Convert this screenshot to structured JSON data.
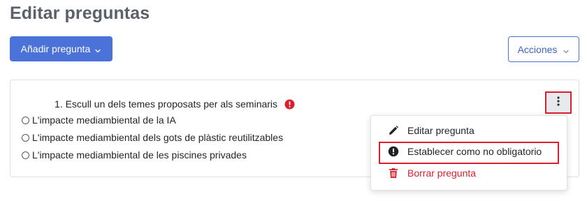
{
  "page": {
    "title": "Editar preguntas"
  },
  "toolbar": {
    "add_question_label": "Añadir pregunta",
    "actions_label": "Acciones"
  },
  "question": {
    "title": "1. Escull un dels temes proposats per als seminaris",
    "options": [
      "L'impacte mediambiental de la IA",
      "L'impacte mediambiental dels gots de plàstic reutilitzables",
      "L'impacte mediambiental de les piscines privades"
    ]
  },
  "menu": {
    "items": [
      {
        "label": "Editar pregunta",
        "icon": "pencil-icon"
      },
      {
        "label": "Establecer como no obligatorio",
        "icon": "exclamation-circle-icon"
      },
      {
        "label": "Borrar pregunta",
        "icon": "trash-icon"
      }
    ]
  },
  "colors": {
    "primary": "#4a72d9",
    "danger": "#d8202f",
    "title_gray": "#5b6069"
  }
}
